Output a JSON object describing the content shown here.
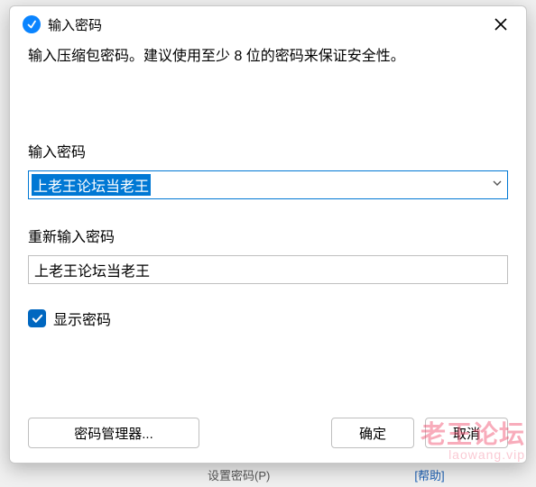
{
  "window": {
    "title": "输入密码"
  },
  "instruction": "输入压缩包密码。建议使用至少 8 位的密码来保证安全性。",
  "fields": {
    "password_label": "输入密码",
    "password_value": "上老王论坛当老王",
    "confirm_label": "重新输入密码",
    "confirm_value": "上老王论坛当老王"
  },
  "checkbox": {
    "show_password_label": "显示密码",
    "checked": true
  },
  "buttons": {
    "password_manager": "密码管理器...",
    "ok": "确定",
    "cancel": "取消"
  },
  "background": {
    "menu_item": "设置密码(P)",
    "help_link": "[帮助]"
  },
  "watermark": {
    "line1": "老王论坛",
    "line2": "laowang.vip"
  }
}
